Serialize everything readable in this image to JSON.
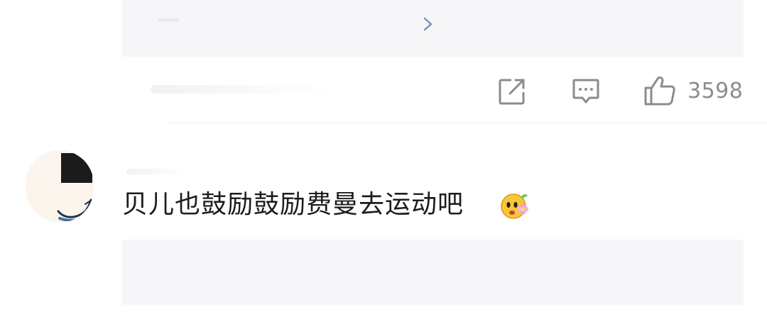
{
  "quote": {
    "arrow_icon": "chevron-right-icon"
  },
  "actions": {
    "share_icon": "share-icon",
    "comment_icon": "comment-icon",
    "like_icon": "thumbs-up-icon",
    "like_count": "3598"
  },
  "comment": {
    "text": "贝儿也鼓励鼓励费曼去运动吧",
    "emoji_icon": "flower-face-emoji-icon"
  },
  "colors": {
    "icon_gray": "#8c8c8c",
    "text_dark": "#1c1c1c",
    "panel_gray": "#f6f6f8"
  }
}
